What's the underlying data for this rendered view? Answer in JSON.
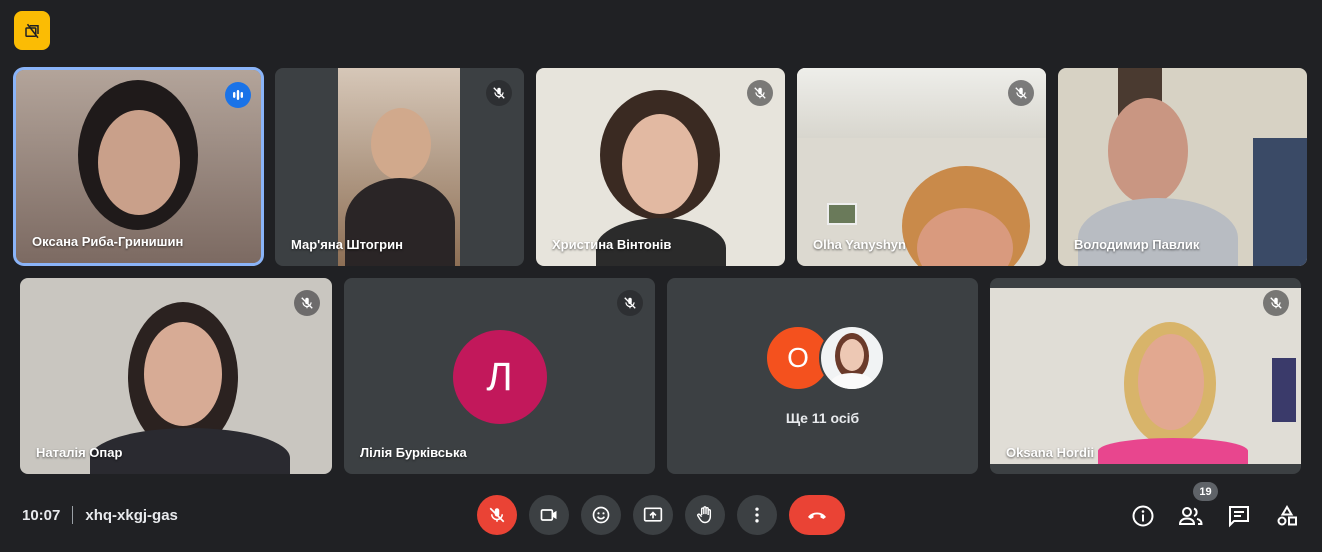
{
  "participants": [
    {
      "name": "Оксана Риба-Гринишин",
      "speaking": true
    },
    {
      "name": "Мар'яна Штогрин",
      "muted": true
    },
    {
      "name": "Христина Вінтонів",
      "muted": true
    },
    {
      "name": "Olha Yanyshyn",
      "muted": true
    },
    {
      "name": "Володимир Павлик",
      "muted": true
    },
    {
      "name": "Наталія Опар",
      "muted": true
    },
    {
      "name": "Лілія Бурківська",
      "initial": "Л",
      "muted": true
    },
    {
      "name": "Oksana Hordii",
      "muted": true
    }
  ],
  "others": {
    "initial": "O",
    "label": "Ще 11 осіб"
  },
  "footer": {
    "time": "10:07",
    "meeting_code": "xhq-xkgj-gas"
  },
  "people_count": "19",
  "colors": {
    "background": "#202124",
    "tile": "#3c4043",
    "accent": "#8ab4f8",
    "danger": "#ea4335",
    "badge": "#fbbc04"
  },
  "icons": [
    "no-recording-icon",
    "mic-off-icon",
    "speaking-icon",
    "camera-icon",
    "emoji-icon",
    "present-icon",
    "raise-hand-icon",
    "more-options-icon",
    "hang-up-icon",
    "info-icon",
    "people-icon",
    "chat-icon",
    "activities-icon"
  ]
}
